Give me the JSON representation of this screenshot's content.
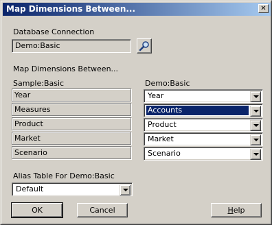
{
  "window": {
    "title": "Map Dimensions Between...",
    "close_glyph": "✕"
  },
  "database_connection": {
    "label": "Database Connection",
    "value": "Demo:Basic",
    "browse_icon": "search-connection-icon"
  },
  "map_heading": "Map Dimensions Between...",
  "source_header": "Sample:Basic",
  "target_header": "Demo:Basic",
  "rows": [
    {
      "source": "Year",
      "target": "Year"
    },
    {
      "source": "Measures",
      "target": "Accounts"
    },
    {
      "source": "Product",
      "target": "Product"
    },
    {
      "source": "Market",
      "target": "Market"
    },
    {
      "source": "Scenario",
      "target": "Scenario"
    }
  ],
  "alias": {
    "label": "Alias Table For Demo:Basic",
    "value": "Default"
  },
  "buttons": {
    "ok": "OK",
    "cancel": "Cancel",
    "help_first": "H",
    "help_rest": "elp"
  },
  "colors": {
    "title_gradient_start": "#0a246a",
    "title_gradient_end": "#a6caf0",
    "selection": "#0a246a",
    "face": "#d4d0c8"
  }
}
